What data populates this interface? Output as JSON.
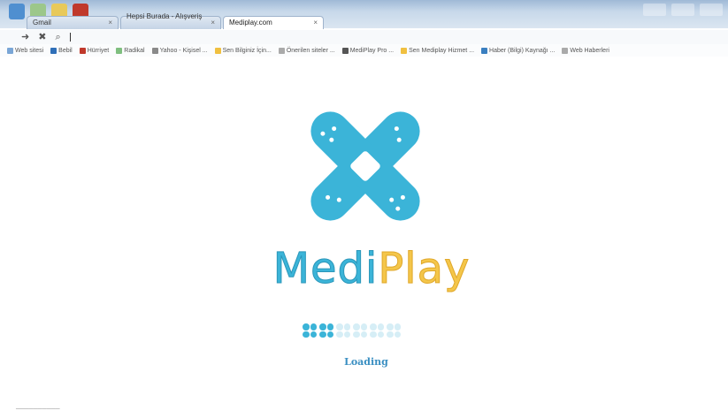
{
  "window": {
    "tabs": [
      {
        "label": "Gmail",
        "active": false
      },
      {
        "label": "Hepsi Burada - Alışveriş ...",
        "active": false
      },
      {
        "label": "Mediplay.com",
        "active": true
      }
    ]
  },
  "navbar": {
    "forward": "➜",
    "stop": "✖",
    "search": "⌕"
  },
  "bookmarks": [
    {
      "label": "Web sitesi",
      "color": "#7aa6d6"
    },
    {
      "label": "Bebil",
      "color": "#2f6fb8"
    },
    {
      "label": "Hürriyet",
      "color": "#c0392b"
    },
    {
      "label": "Radikal",
      "color": "#7fbf7f"
    },
    {
      "label": "Yahoo - Kişisel ...",
      "color": "#8a8a8a"
    },
    {
      "label": "Sen Bilginiz İçin...",
      "color": "#f0c040"
    },
    {
      "label": "Önerilen siteler ...",
      "color": "#aaaaaa"
    },
    {
      "label": "MediPlay Pro ...",
      "color": "#555555"
    },
    {
      "label": "Sen Mediplay Hizmet ...",
      "color": "#f0c040"
    },
    {
      "label": "Haber (Bilgi) Kaynağı ...",
      "color": "#3a7fc0"
    },
    {
      "label": "Web Haberleri",
      "color": "#aaaaaa"
    }
  ],
  "brand": {
    "name_part1": "Medi",
    "name_part2": "Play"
  },
  "loading": {
    "text": "Loading",
    "filled_cells": 2,
    "total_cells": 6
  },
  "colors": {
    "accent_blue": "#3bb4d8",
    "accent_yellow": "#f4c64a"
  }
}
